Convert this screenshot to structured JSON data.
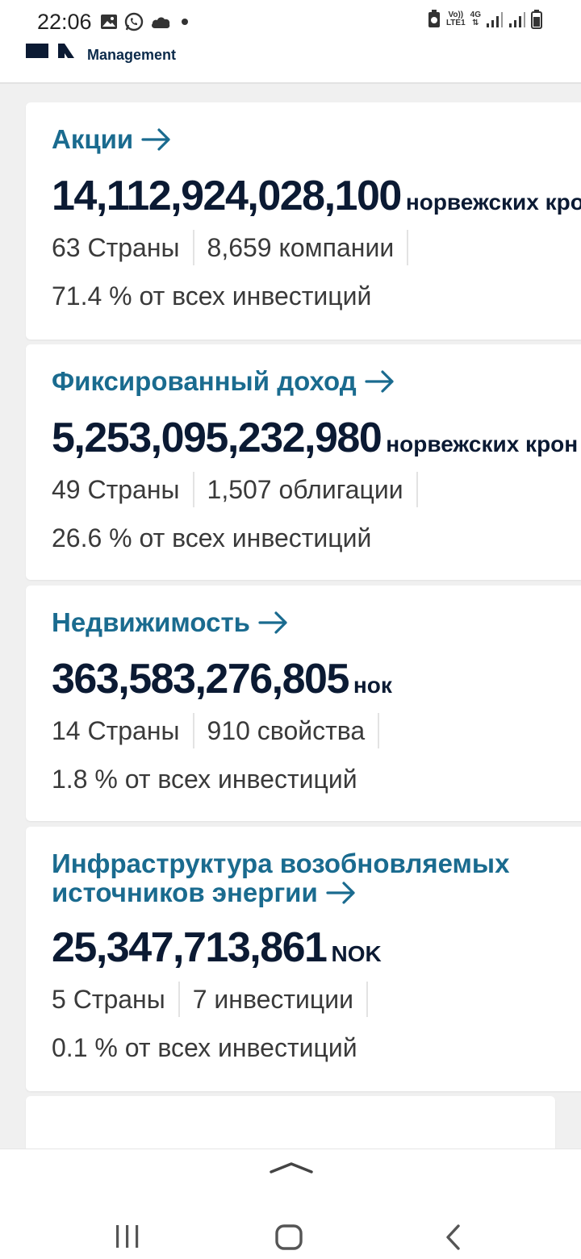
{
  "status_bar": {
    "time": "22:06",
    "network_badge_top": "Vo))",
    "network_badge_bottom": "LTE1",
    "data_badge": "4G"
  },
  "header": {
    "brand_subtitle": "Management"
  },
  "cards": [
    {
      "title": "Акции",
      "amount": "14,112,924,028,100",
      "currency": "норвежских кро",
      "countries": "63 Страны",
      "count": "8,659 компании",
      "share": "71.4 % от всех инвестиций"
    },
    {
      "title": "Фиксированный доход",
      "amount": "5,253,095,232,980",
      "currency": "норвежских крон",
      "countries": "49 Страны",
      "count": "1,507 облигации",
      "share": "26.6 % от всех инвестиций"
    },
    {
      "title": "Недвижимость",
      "amount": "363,583,276,805",
      "currency": "нок",
      "countries": "14 Страны",
      "count": "910 свойства",
      "share": "1.8 % от всех инвестиций"
    },
    {
      "title_line1": "Инфраструктура возобновляемых",
      "title_line2": "источников энергии",
      "amount": "25,347,713,861",
      "currency": "NOK",
      "countries": "5 Страны",
      "count": "7 инвестиции",
      "share": "0.1 % от всех инвестиций"
    }
  ],
  "colors": {
    "accent": "#1a6b8f",
    "text_dark": "#0b1a33",
    "background": "#f0f0f0"
  }
}
